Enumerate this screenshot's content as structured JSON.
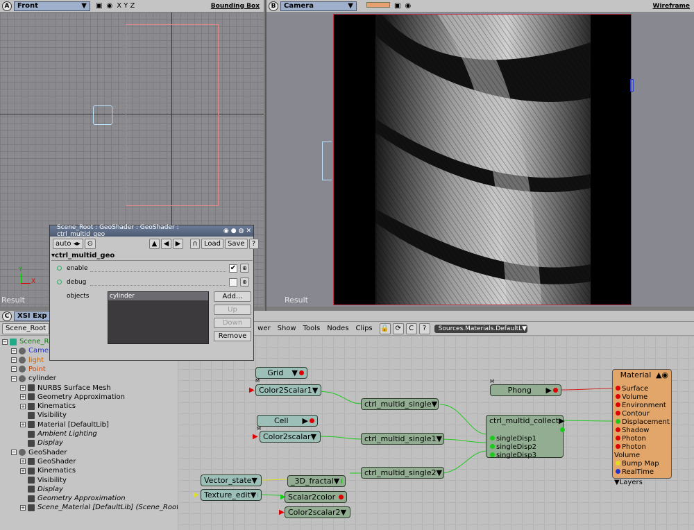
{
  "viewport_a": {
    "letter": "A",
    "view": "Front",
    "axes": "X  Y  Z",
    "mode": "Bounding Box",
    "result": "Result",
    "axis_y": "Y",
    "axis_x": "X"
  },
  "viewport_b": {
    "letter": "B",
    "view": "Camera",
    "mode": "Wireframe",
    "result": "Result"
  },
  "ppg": {
    "title": "Scene_Root : GeoShader : GeoShader : ctrl_multid_geo",
    "auto": "auto",
    "load": "Load",
    "save": "Save",
    "help": "?",
    "section": "ctrl_multid_geo",
    "enable_label": "enable",
    "debug_label": "debug",
    "objects_label": "objects",
    "objects_list": [
      "cylinder"
    ],
    "add": "Add...",
    "up": "Up",
    "down": "Down",
    "remove": "Remove"
  },
  "explorer": {
    "letter": "C",
    "title": "XSI Exp",
    "scope": "Scene_Root"
  },
  "rendertree_toolbar": {
    "viewer": "wer",
    "show": "Show",
    "tools": "Tools",
    "nodes": "Nodes",
    "clips": "Clips",
    "source": "Sources.Materials.DefaultL"
  },
  "tree": [
    {
      "label": "Scene_Ro",
      "depth": 0,
      "color": "#0a7a0a"
    },
    {
      "label": "Camer",
      "depth": 1,
      "color": "#2233cc"
    },
    {
      "label": "light",
      "depth": 1,
      "color": "#cc6600"
    },
    {
      "label": "Point",
      "depth": 1,
      "color": "#cc4400"
    },
    {
      "label": "cylinder",
      "depth": 1,
      "color": "#000000"
    },
    {
      "label": "NURBS Surface Mesh",
      "depth": 2,
      "color": "#000000"
    },
    {
      "label": "Geometry Approximation",
      "depth": 2,
      "color": "#000000"
    },
    {
      "label": "Kinematics",
      "depth": 2,
      "color": "#000000"
    },
    {
      "label": "Visibility",
      "depth": 2,
      "color": "#000000"
    },
    {
      "label": "Material [DefaultLib]",
      "depth": 2,
      "color": "#000000"
    },
    {
      "label": "Ambient Lighting",
      "depth": 2,
      "color": "#000000",
      "italic": true
    },
    {
      "label": "Display",
      "depth": 2,
      "color": "#000000",
      "italic": true
    },
    {
      "label": "GeoShader",
      "depth": 1,
      "color": "#000000"
    },
    {
      "label": "GeoShader",
      "depth": 2,
      "color": "#000000"
    },
    {
      "label": "Kinematics",
      "depth": 2,
      "color": "#000000"
    },
    {
      "label": "Visibility",
      "depth": 2,
      "color": "#000000"
    },
    {
      "label": "Display",
      "depth": 2,
      "color": "#000000",
      "italic": true
    },
    {
      "label": "Geometry Approximation",
      "depth": 2,
      "color": "#000000",
      "italic": true
    },
    {
      "label": "Scene_Material [DefaultLib] (Scene_Root)",
      "depth": 2,
      "color": "#000000",
      "italic": true
    }
  ],
  "nodes": {
    "grid": "Grid",
    "color2scalar1": "Color2Scalar1",
    "cell": "Cell",
    "color2scalar": "Color2scalar",
    "vector_state": "Vector_state",
    "texture_edit": "Texture_edit",
    "fractal": "_3D_fractal",
    "scalar2color": "Scalar2color",
    "color2scalar2": "Color2scalar2",
    "single": "ctrl_multid_single",
    "single1": "ctrl_multid_single1",
    "single2": "ctrl_multid_single2",
    "phong": "Phong",
    "collect": "ctrl_multid_collect",
    "collect_ports": [
      "singleDisp1",
      "singleDisp2",
      "singleDisp3"
    ],
    "material": "Material",
    "material_ports": [
      "Surface",
      "Volume",
      "Environment",
      "Contour",
      "Displacement",
      "Shadow",
      "Photon",
      "Photon Volume",
      "Bump Map",
      "RealTime"
    ],
    "layers": "Layers",
    "m_label": "M"
  }
}
